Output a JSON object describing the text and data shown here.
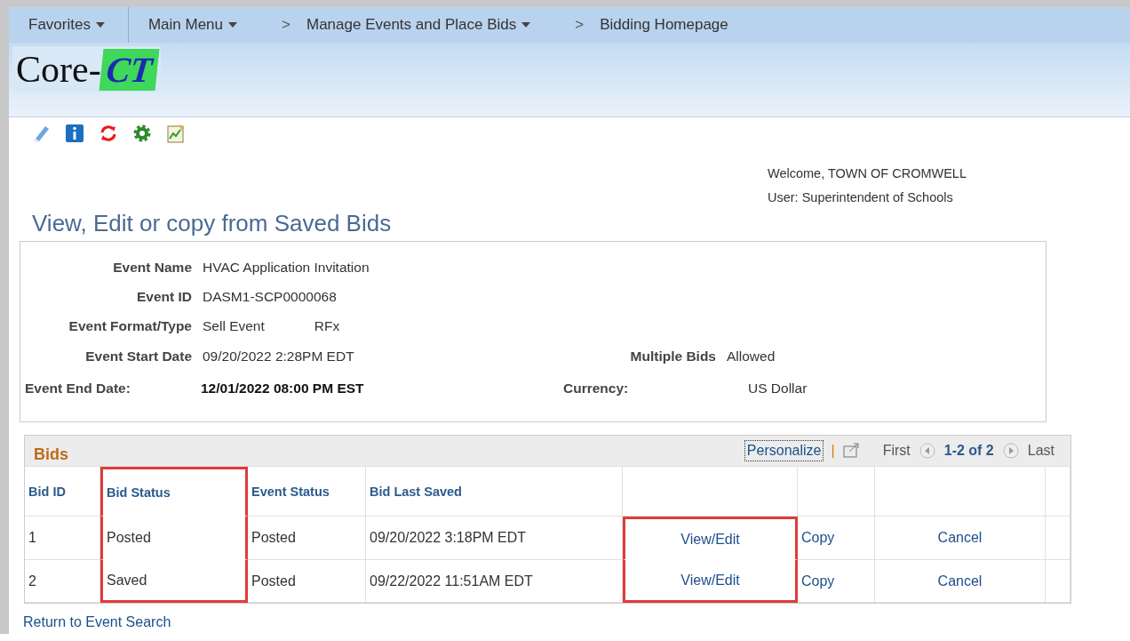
{
  "nav": {
    "items": [
      {
        "kind": "menu",
        "label": "Favorites"
      },
      {
        "kind": "menu",
        "label": "Main Menu"
      },
      {
        "kind": "separator",
        "label": ">"
      },
      {
        "kind": "menu",
        "label": "Manage Events and Place Bids"
      },
      {
        "kind": "separator",
        "label": ">"
      },
      {
        "kind": "link",
        "label": "Bidding Homepage"
      }
    ]
  },
  "logo": {
    "prefix": "Core-",
    "mark": "CT"
  },
  "welcome": {
    "greeting": "Welcome, TOWN OF CROMWELL",
    "user": "User: Superintendent of Schools"
  },
  "page_title": "View, Edit or copy from Saved Bids",
  "event_rows": [
    {
      "left": {
        "kind": "standard",
        "label": "Event Name",
        "values": [
          "HVAC Application Invitation"
        ]
      }
    },
    {
      "left": {
        "kind": "standard",
        "label": "Event ID",
        "values": [
          "DASM1-SCP0000068"
        ]
      }
    },
    {
      "left": {
        "kind": "standard",
        "label": "Event Format/Type",
        "values": [
          "Sell Event",
          "RFx"
        ]
      }
    },
    {
      "left": {
        "kind": "standard",
        "label": "Event Start Date",
        "values": [
          "09/20/2022  2:28PM EDT"
        ]
      },
      "right": {
        "kind": "standard",
        "label": "Multiple Bids",
        "value": "Allowed"
      }
    },
    {
      "left": {
        "kind": "emphasis",
        "label": "Event End Date:",
        "values": [
          "12/01/2022 08:00 PM EST"
        ]
      },
      "right": {
        "kind": "emphasis",
        "label": "Currency:",
        "value": "US Dollar"
      }
    }
  ],
  "bids": {
    "title": "Bids",
    "personalize": "Personalize",
    "separator": "|",
    "first": "First",
    "range": "1-2 of 2",
    "last": "Last",
    "columns": [
      {
        "label": "Bid ID",
        "highlighted": false
      },
      {
        "label": "Bid Status",
        "highlighted": true
      },
      {
        "label": "Event Status",
        "highlighted": false
      },
      {
        "label": "Bid Last Saved",
        "highlighted": false
      },
      {
        "highlighted": false
      },
      {
        "highlighted": false
      },
      {
        "highlighted": false
      },
      {
        "highlighted": false
      }
    ],
    "rows": [
      {
        "cells": [
          {
            "kind": "text",
            "text": "1",
            "highlighted": false
          },
          {
            "kind": "text",
            "text": "Posted",
            "highlighted": true
          },
          {
            "kind": "text",
            "text": "Posted",
            "highlighted": false
          },
          {
            "kind": "text",
            "text": "09/20/2022  3:18PM EDT",
            "highlighted": false
          },
          {
            "kind": "link",
            "text": "View/Edit",
            "highlighted": true
          },
          {
            "kind": "link",
            "text": "Copy",
            "highlighted": false
          },
          {
            "kind": "link",
            "text": "Cancel",
            "highlighted": false
          },
          {
            "kind": "empty",
            "highlighted": false
          }
        ]
      },
      {
        "cells": [
          {
            "kind": "text",
            "text": "2",
            "highlighted": false
          },
          {
            "kind": "text",
            "text": "Saved",
            "highlighted": true
          },
          {
            "kind": "text",
            "text": "Posted",
            "highlighted": false
          },
          {
            "kind": "text",
            "text": "09/22/2022 11:51AM EDT",
            "highlighted": false
          },
          {
            "kind": "link",
            "text": "View/Edit",
            "highlighted": true
          },
          {
            "kind": "link",
            "text": "Copy",
            "highlighted": false
          },
          {
            "kind": "link",
            "text": "Cancel",
            "highlighted": false
          },
          {
            "kind": "empty",
            "highlighted": false
          }
        ]
      }
    ]
  },
  "return_link": "Return to Event Search"
}
